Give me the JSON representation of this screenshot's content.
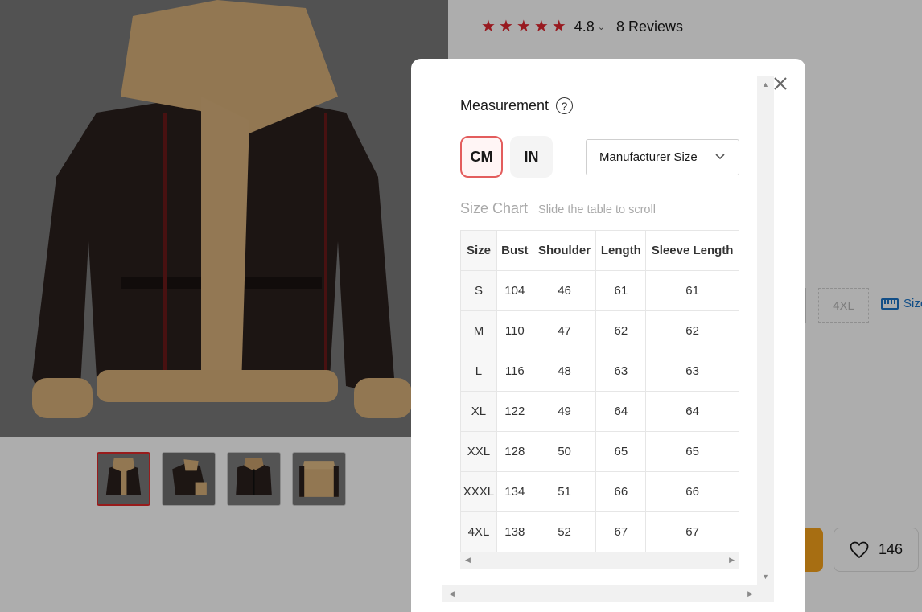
{
  "product": {
    "rating_value": "4.8",
    "stars": 5,
    "reviews_label": "8 Reviews",
    "size_visible": "4XL",
    "size_guide_label": "Size",
    "wishlist_count": "146",
    "thumbnail_count": 4,
    "active_thumbnail": 1
  },
  "colors": {
    "star": "#e0262e",
    "accent_red": "#e02a2a",
    "link_blue": "#1a73c8",
    "buy_orange": "#f7a21b"
  },
  "modal": {
    "title": "Measurement",
    "help_glyph": "?",
    "units": [
      {
        "label": "CM",
        "selected": true
      },
      {
        "label": "IN",
        "selected": false
      }
    ],
    "size_system": {
      "selected": "Manufacturer Size"
    },
    "chart_title": "Size Chart",
    "chart_hint": "Slide the table to scroll",
    "table": {
      "headers": [
        "Size",
        "Bust",
        "Shoulder",
        "Length",
        "Sleeve Length"
      ],
      "rows": [
        [
          "S",
          "104",
          "46",
          "61",
          "61"
        ],
        [
          "M",
          "110",
          "47",
          "62",
          "62"
        ],
        [
          "L",
          "116",
          "48",
          "63",
          "63"
        ],
        [
          "XL",
          "122",
          "49",
          "64",
          "64"
        ],
        [
          "XXL",
          "128",
          "50",
          "65",
          "65"
        ],
        [
          "XXXL",
          "134",
          "51",
          "66",
          "66"
        ],
        [
          "4XL",
          "138",
          "52",
          "67",
          "67"
        ]
      ]
    }
  }
}
